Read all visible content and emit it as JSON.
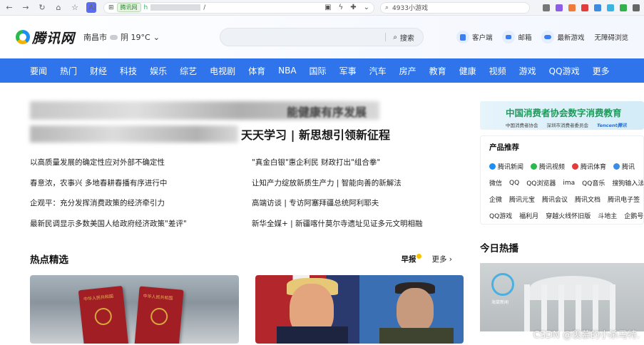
{
  "browser": {
    "ai_badge": "Ai",
    "site_chip": "腾讯网",
    "url_prefix": "h",
    "url_suffix": "/",
    "search_text": "4933小游戏"
  },
  "header": {
    "logo_text": "腾讯网",
    "city": "南昌市",
    "weather": "阴 19°C",
    "search_button": "搜索",
    "quick_links": [
      "客户端",
      "邮箱",
      "最新游戏",
      "无障碍浏览"
    ]
  },
  "channels": [
    "要闻",
    "热门",
    "财经",
    "科技",
    "娱乐",
    "综艺",
    "电视剧",
    "体育",
    "NBA",
    "国际",
    "军事",
    "汽车",
    "房产",
    "教育",
    "健康",
    "视频",
    "游戏",
    "QQ游戏",
    "更多"
  ],
  "headlines": {
    "line1_tail": "能健康有序发展",
    "line2_visible": "天天学习 | 新思想引领新征程"
  },
  "news": {
    "left": [
      "以高质量发展的确定性应对外部不确定性",
      "春意浓，农事兴 多地春耕春播有序进行中",
      "企观平：充分发挥消费政策的经济牵引力",
      "最新民调显示多数美国人给政府经济政策\"差评\""
    ],
    "right": [
      "\"真金白银\"惠企利民 财政打出\"组合拳\"",
      "让知产力绽放新质生产力 | 智能向善的新解法",
      "高端访谈 | 专访阿塞拜疆总统阿利耶夫",
      "新华全媒+ | 新疆喀什莫尔寺遗址见证多元文明相融"
    ]
  },
  "featured": {
    "title": "热点精选",
    "zaobao": "早报",
    "more": "更多",
    "passport_text": "中华人民共和国"
  },
  "banner": {
    "title": "中国消费者协会数字消费教育",
    "org1": "中国消费者协会",
    "org2": "深圳市消费者委员会",
    "org3": "Tencent腾讯"
  },
  "products": {
    "title": "产品推荐",
    "row1": [
      "腾讯新闻",
      "腾讯视频",
      "腾讯体育",
      "腾讯"
    ],
    "row2": [
      "微信",
      "QQ",
      "QQ浏览器",
      "ima",
      "QQ音乐",
      "搜狗输入法"
    ],
    "row3": [
      "企微",
      "腾讯元宝",
      "腾讯会议",
      "腾讯文档",
      "腾讯电子签"
    ],
    "row4": [
      "QQ游戏",
      "福利月",
      "穿越火线怀旧版",
      "斗地主",
      "企鹅号"
    ]
  },
  "hot": {
    "title": "今日热播",
    "logo_text": "海棠新闻"
  },
  "watermark": "CSDN @羡慕的小杀马特."
}
